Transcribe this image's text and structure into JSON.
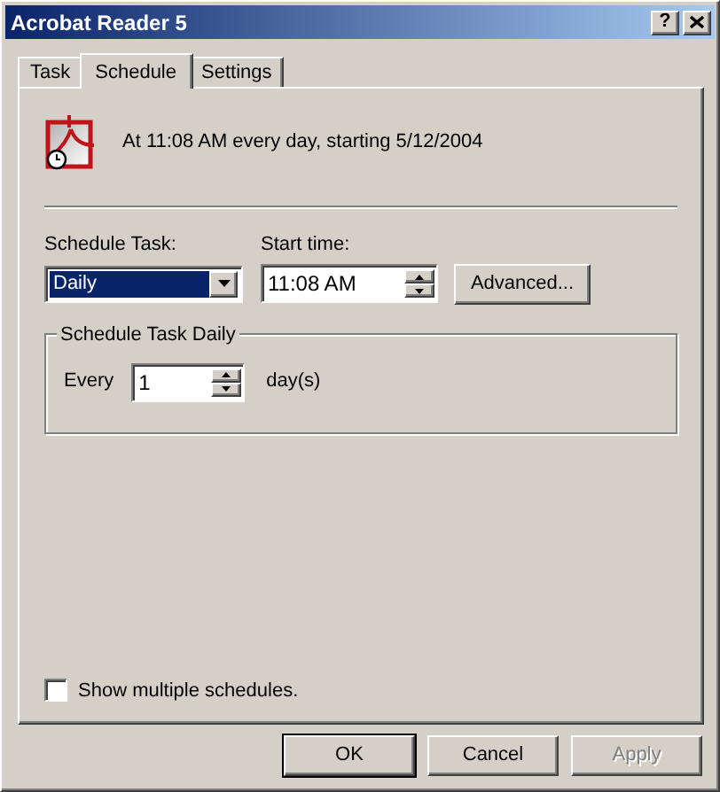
{
  "window": {
    "title": "Acrobat Reader 5",
    "help_button": "?"
  },
  "tabs": [
    {
      "label": "Task",
      "selected": false
    },
    {
      "label": "Schedule",
      "selected": true
    },
    {
      "label": "Settings",
      "selected": false
    }
  ],
  "summary": "At 11:08 AM every day, starting 5/12/2004",
  "schedule_task": {
    "label": "Schedule Task:",
    "value": "Daily"
  },
  "start_time": {
    "label": "Start time:",
    "value": "11:08 AM"
  },
  "advanced_button": "Advanced...",
  "group": {
    "title": "Schedule Task Daily",
    "every_label": "Every",
    "value": "1",
    "unit": "day(s)"
  },
  "show_multiple": {
    "label": "Show multiple schedules.",
    "checked": false
  },
  "buttons": [
    {
      "label": "OK",
      "default": true,
      "disabled": false
    },
    {
      "label": "Cancel",
      "default": false,
      "disabled": false
    },
    {
      "label": "Apply",
      "default": false,
      "disabled": true
    }
  ]
}
